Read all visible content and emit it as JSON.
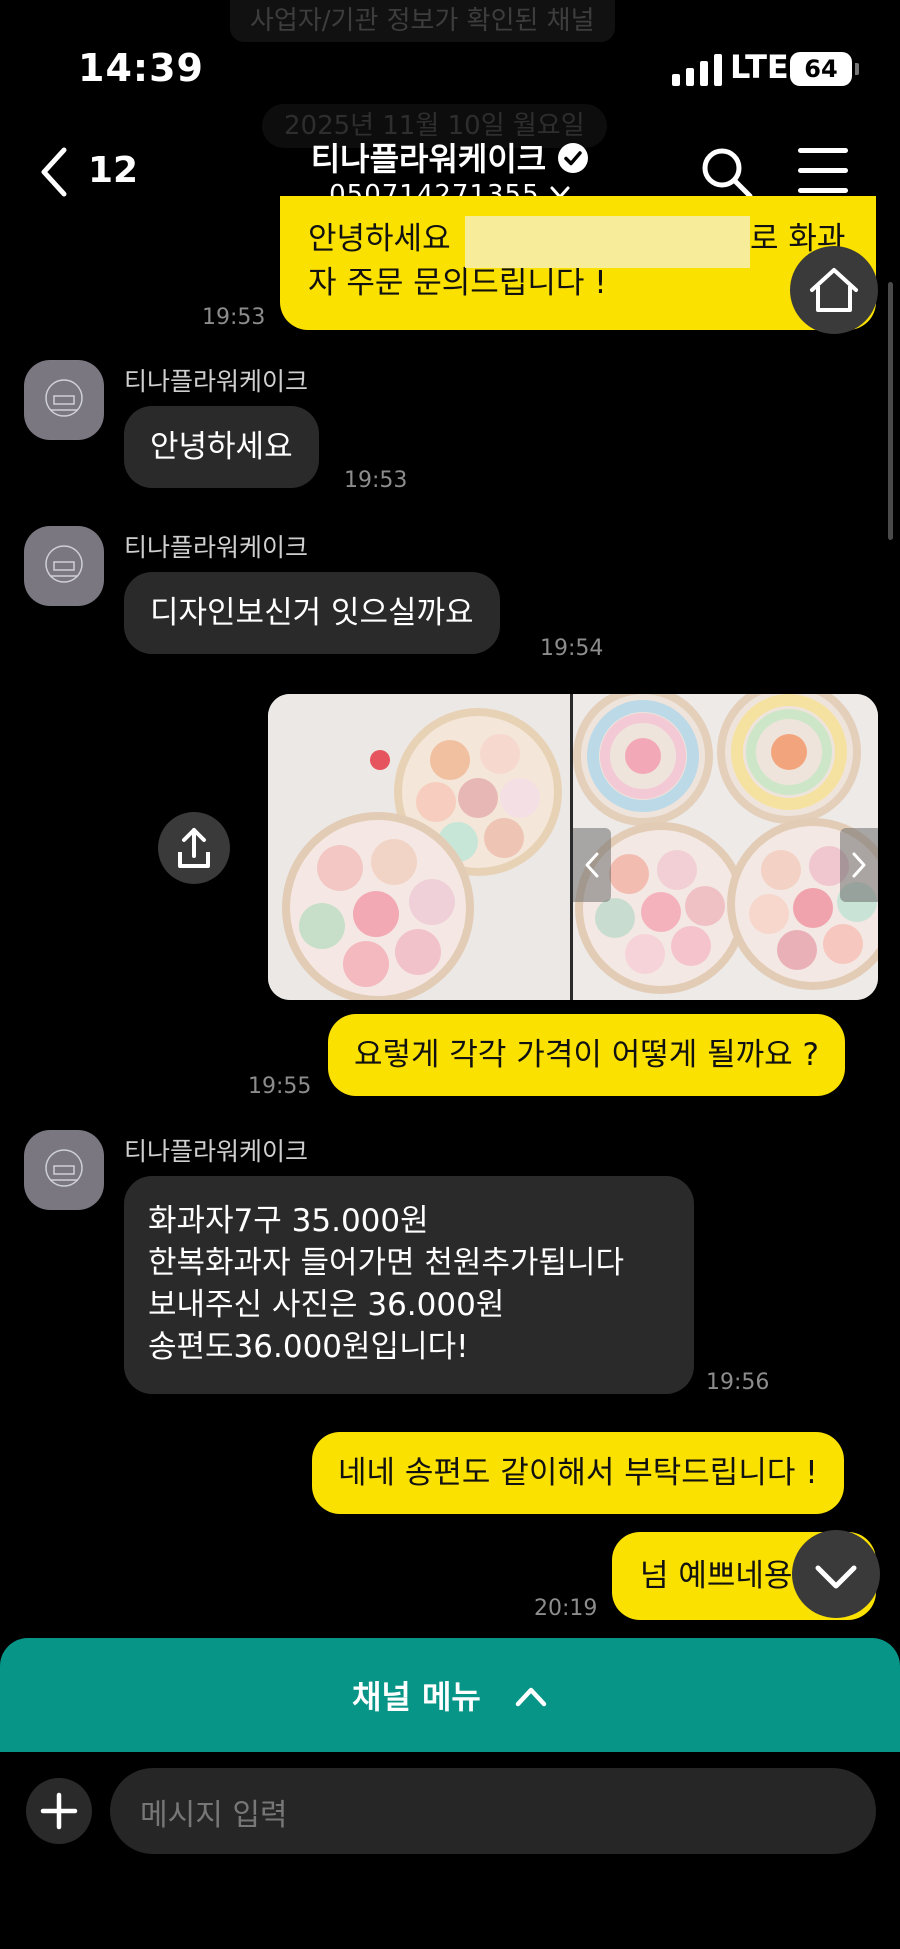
{
  "status_bar": {
    "time": "14:39",
    "network": "LTE",
    "battery": "64"
  },
  "banners": {
    "business_info": "사업자/기관 정보가 확인된 채널",
    "date": "2025년 11월 10일 월요일"
  },
  "header": {
    "back_count": "12",
    "title": "티나플라워케이크",
    "phone": "050714271355"
  },
  "messages": {
    "m1": {
      "line1": "안녕하세요",
      "line1_end": "로 화과",
      "line2": "자 주문 문의드립니다 !",
      "time": "19:53"
    },
    "m2": {
      "sender": "티나플라워케이크",
      "text": "안녕하세요",
      "time": "19:53"
    },
    "m3": {
      "sender": "티나플라워케이크",
      "text": "디자인보신거 잇으실까요",
      "time": "19:54"
    },
    "m5": {
      "text": "요렇게 각각 가격이 어떻게 될까요 ?",
      "time": "19:55"
    },
    "m6": {
      "sender": "티나플라워케이크",
      "lines": [
        "화과자7구 35.000원",
        "한복화과자 들어가면 천원추가됩니다",
        "보내주신 사진은 36.000원",
        "송편도36.000원입니다!"
      ],
      "time": "19:56"
    },
    "m7": {
      "text": "네네 송편도 같이해서 부탁드립니다 !"
    },
    "m8": {
      "text": "넘 예쁘네용",
      "time": "20:19"
    }
  },
  "channel_menu": {
    "label": "채널 메뉴"
  },
  "input": {
    "placeholder": "메시지 입력"
  },
  "colors": {
    "my_bubble": "#fae100",
    "their_bubble": "#2a2a2a",
    "channel_menu": "#079587",
    "background": "#000000"
  },
  "icons": [
    "back-icon",
    "verified-icon",
    "chevron-down-icon",
    "search-icon",
    "hamburger-icon",
    "home-icon",
    "share-icon",
    "chevron-left-icon",
    "chevron-right-icon",
    "chevron-up-icon",
    "plus-icon",
    "scroll-down-icon"
  ]
}
